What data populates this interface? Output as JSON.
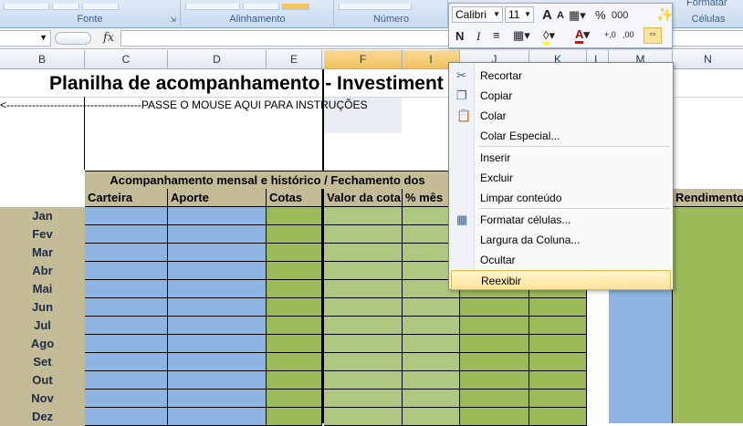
{
  "ribbon": {
    "groups": [
      {
        "label": "Fonte"
      },
      {
        "label": "Alinhamento"
      },
      {
        "label": "Número"
      },
      {
        "label": "Células"
      }
    ],
    "partial_text": "Formatar"
  },
  "formula_bar": {
    "fx": "fx",
    "name_value": "",
    "formula_value": ""
  },
  "columns": [
    "B",
    "C",
    "D",
    "E",
    "F",
    "I",
    "J",
    "K",
    "L",
    "M",
    "N"
  ],
  "sheet": {
    "title": "Planilha de acompanhamento - Investiment",
    "instruction": "<-------------------------------------PASSE O MOUSE AQUI PARA INSTRUÇÕES",
    "banner": "Acompanhamento mensal e histórico / Fechamento dos",
    "headers": [
      "Carteira",
      "Aporte",
      "Cotas",
      "Valor da cota",
      "% mês",
      "Rendimento"
    ],
    "months": [
      "Jan",
      "Fev",
      "Mar",
      "Abr",
      "Mai",
      "Jun",
      "Jul",
      "Ago",
      "Set",
      "Out",
      "Nov",
      "Dez"
    ]
  },
  "mini_toolbar": {
    "font": "Calibri",
    "size": "11",
    "grow": "A",
    "shrink": "A",
    "percent": "%",
    "thousands": "000",
    "bold": "N",
    "italic": "I",
    "decimals_add": "+,0",
    "decimals_remove": ",00"
  },
  "context_menu": {
    "items": [
      {
        "label": "Recortar",
        "icon": "scissors-icon"
      },
      {
        "label": "Copiar",
        "icon": "copy-icon"
      },
      {
        "label": "Colar",
        "icon": "paste-icon"
      },
      {
        "label": "Colar Especial..."
      },
      {
        "label": "Inserir"
      },
      {
        "label": "Excluir"
      },
      {
        "label": "Limpar conteúdo"
      },
      {
        "label": "Formatar células...",
        "icon": "format-cells-icon"
      },
      {
        "label": "Largura da Coluna..."
      },
      {
        "label": "Ocultar"
      },
      {
        "label": "Reexibir"
      }
    ],
    "highlighted": "Reexibir"
  },
  "colors": {
    "tan": "#c4bc96",
    "blue": "#8db4e2",
    "green": "#9bbb59",
    "green_light": "#aec881",
    "highlight": "#fde29a",
    "selected_col": "#f1c15f"
  }
}
